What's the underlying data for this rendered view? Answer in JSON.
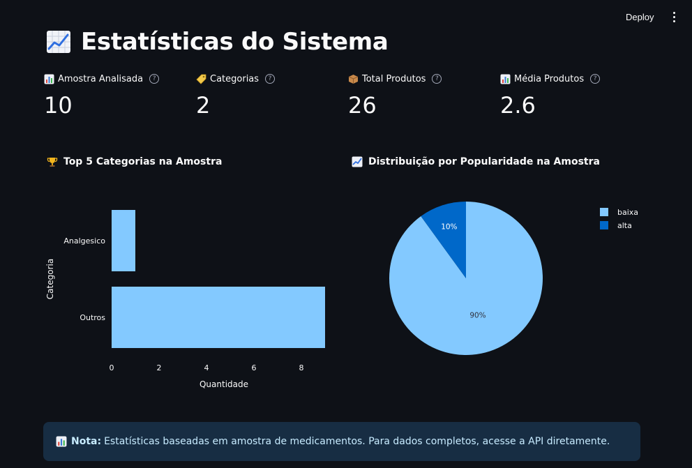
{
  "toolbar": {
    "deploy_label": "Deploy"
  },
  "page": {
    "title": "Estatísticas do Sistema"
  },
  "metrics": [
    {
      "label": "Amostra Analisada",
      "value": "10",
      "icon": "bar-chart-icon"
    },
    {
      "label": "Categorias",
      "value": "2",
      "icon": "tag-icon"
    },
    {
      "label": "Total Produtos",
      "value": "26",
      "icon": "package-icon"
    },
    {
      "label": "Média Produtos",
      "value": "2.6",
      "icon": "bar-chart-icon"
    }
  ],
  "sections": {
    "bar_title": "Top 5 Categorias na Amostra",
    "pie_title": "Distribuição por Popularidade na Amostra"
  },
  "chart_data": [
    {
      "type": "bar",
      "orientation": "horizontal",
      "categories": [
        "Analgesico",
        "Outros"
      ],
      "values": [
        1,
        9
      ],
      "xlabel": "Quantidade",
      "ylabel": "Categoria",
      "xlim": [
        0,
        9
      ],
      "xticks": [
        "0",
        "2",
        "4",
        "6",
        "8"
      ],
      "color": "#83c9ff",
      "grid": false
    },
    {
      "type": "pie",
      "labels": [
        "baixa",
        "alta"
      ],
      "values": [
        90,
        10
      ],
      "value_labels": [
        "90%",
        "10%"
      ],
      "colors": [
        "#83c9ff",
        "#0068c9"
      ],
      "legend_position": "top-right"
    }
  ],
  "note": {
    "bold": "Nota:",
    "text": "Estatísticas baseadas em amostra de medicamentos. Para dados completos, acesse a API diretamente."
  },
  "colors": {
    "background": "#0e1117",
    "note_bg": "#172d43",
    "accent_light": "#83c9ff",
    "accent_dark": "#0068c9"
  }
}
